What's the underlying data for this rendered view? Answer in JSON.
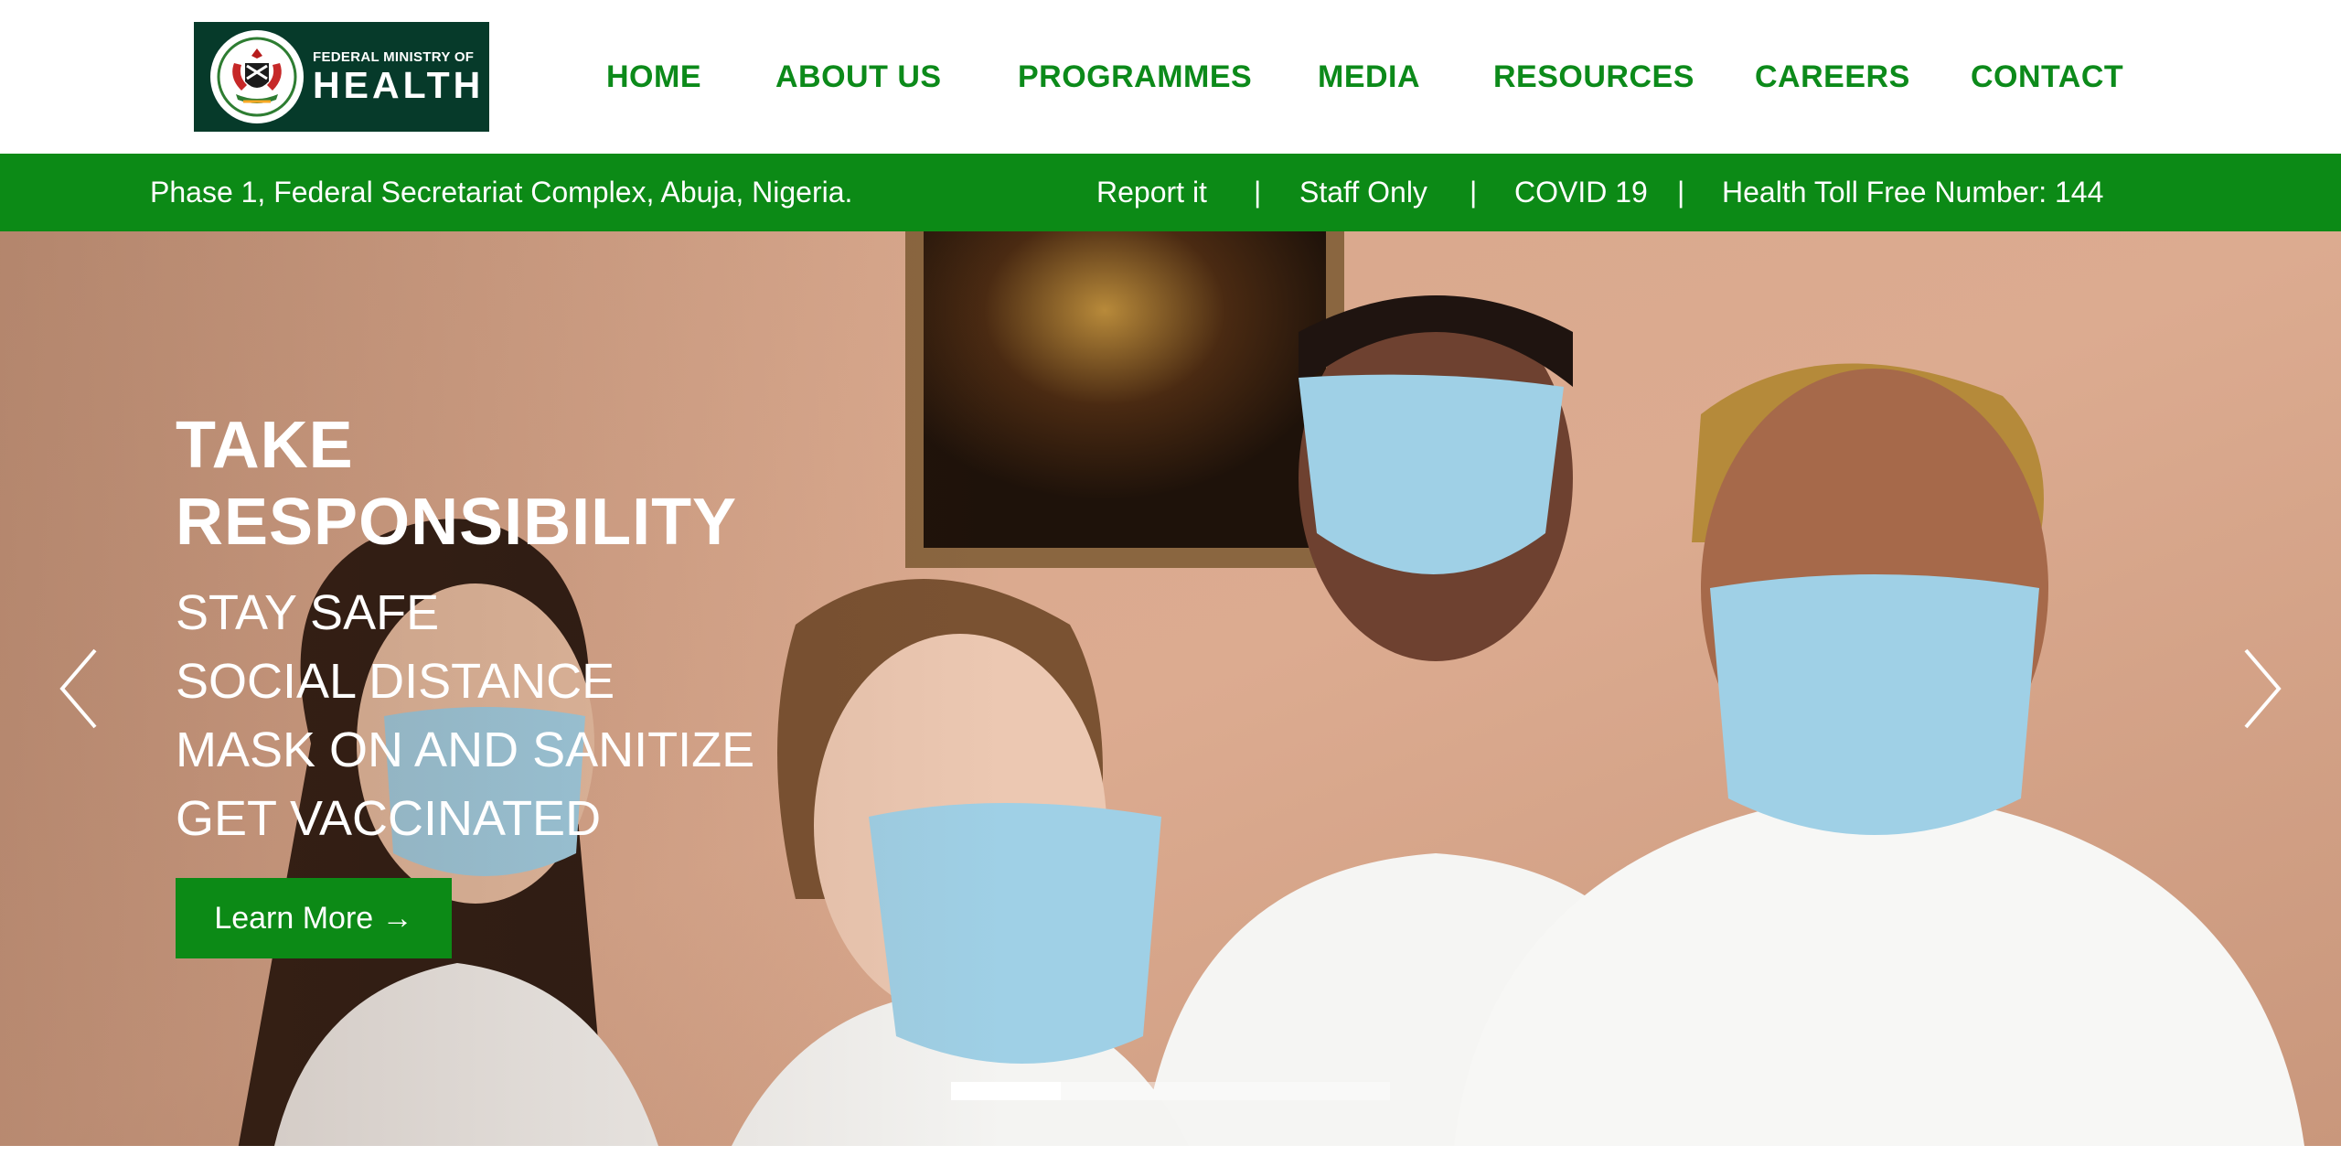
{
  "logo": {
    "line1": "FEDERAL MINISTRY OF",
    "line2": "HEALTH",
    "emblem_icon": "coat-of-arms-icon"
  },
  "nav": {
    "items": [
      "HOME",
      "ABOUT  US",
      "PROGRAMMES",
      "MEDIA",
      "RESOURCES",
      "CAREERS",
      "CONTACT"
    ]
  },
  "infobar": {
    "address": "Phase 1, Federal Secretariat Complex, Abuja, Nigeria.",
    "links": [
      "Report it",
      "Staff Only",
      "COVID 19"
    ],
    "hotline": "Health Toll Free Number: 144",
    "separator": "|"
  },
  "hero": {
    "title_line1": "TAKE",
    "title_line2": "RESPONSIBILITY",
    "lines": [
      "STAY SAFE",
      "SOCIAL DISTANCE",
      "MASK ON AND SANITIZE",
      "GET VACCINATED"
    ],
    "cta_label": "Learn More →",
    "prev_icon": "chevron-left-icon",
    "next_icon": "chevron-right-icon",
    "slide_count": 4,
    "active_slide": 1
  },
  "colors": {
    "brand_green": "#0c8a16",
    "logo_bg": "#063a2a",
    "nav_text": "#0c8a1a",
    "hero_wall": "#d9a88c",
    "mask_blue": "#9fd0e6"
  }
}
